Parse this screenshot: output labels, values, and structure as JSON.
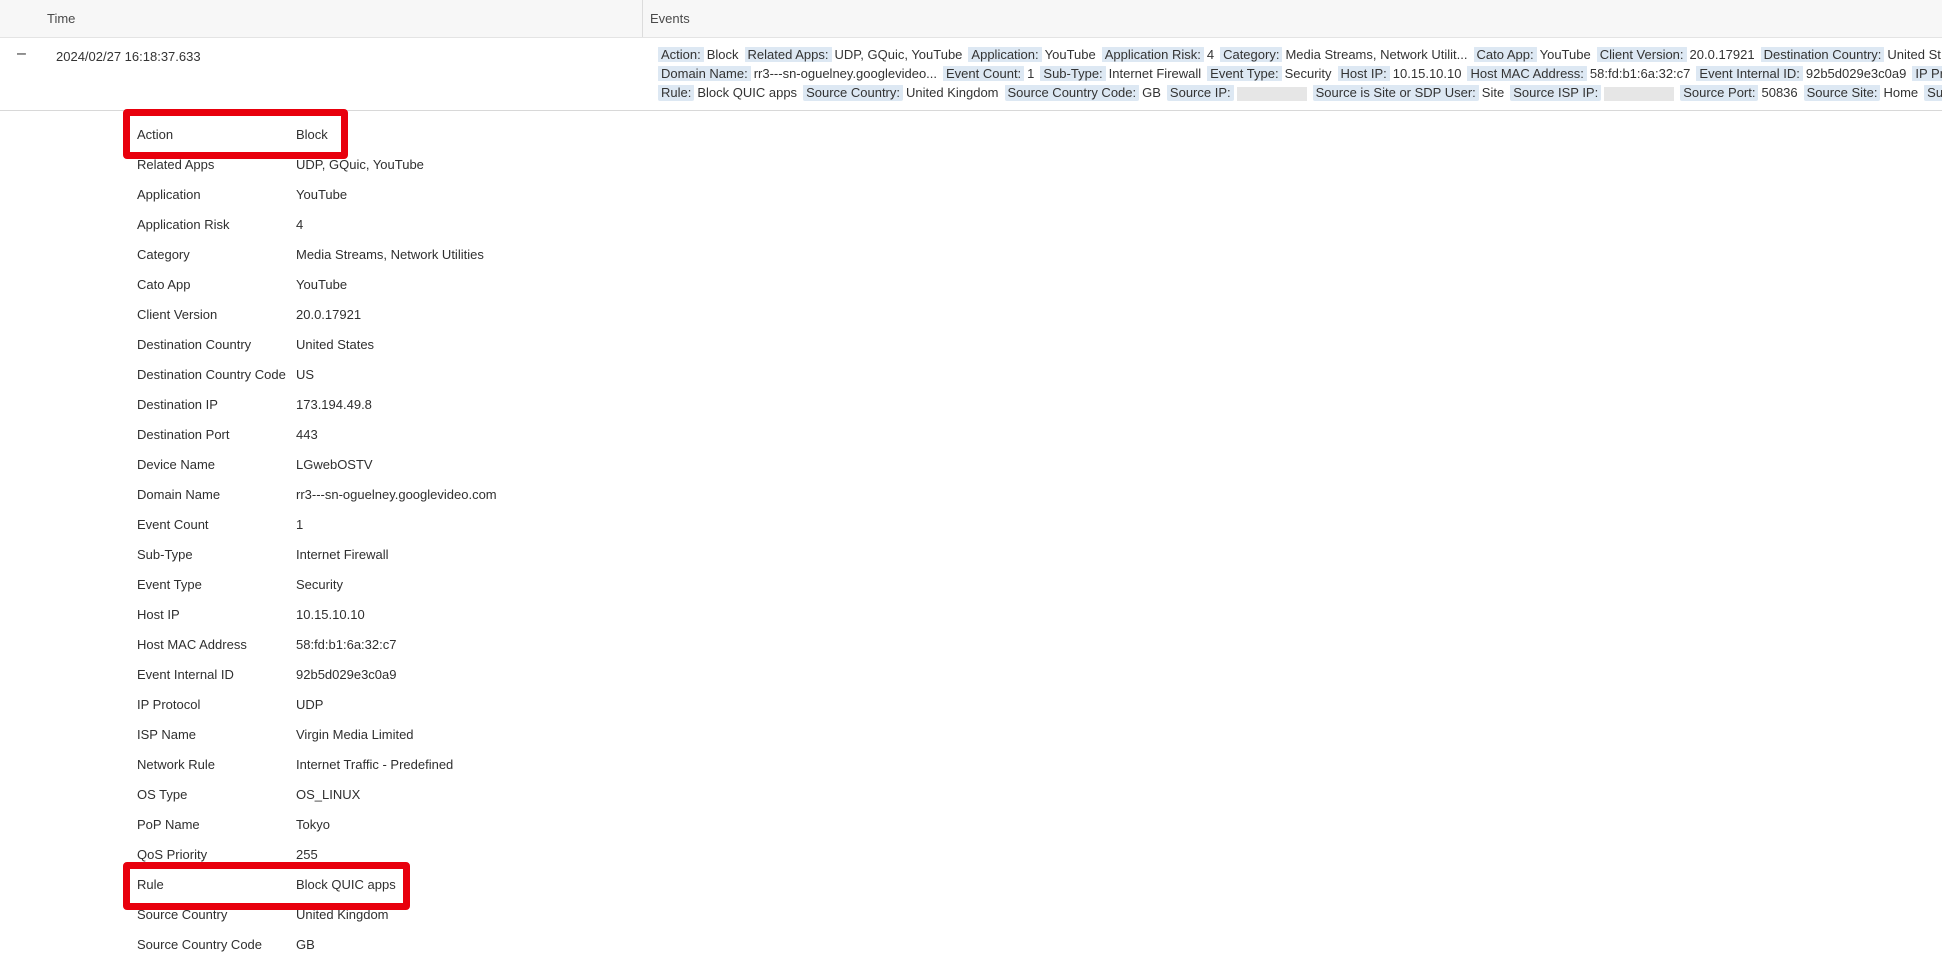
{
  "header": {
    "time_label": "Time",
    "events_label": "Events"
  },
  "event": {
    "toggle_symbol": "–",
    "time": "2024/02/27 16:18:37.633",
    "summary_line1": [
      {
        "k": "Action:",
        "v": "Block"
      },
      {
        "k": "Related Apps:",
        "v": "UDP, GQuic, YouTube"
      },
      {
        "k": "Application:",
        "v": "YouTube"
      },
      {
        "k": "Application Risk:",
        "v": "4"
      },
      {
        "k": "Category:",
        "v": "Media Streams, Network Utilit..."
      },
      {
        "k": "Cato App:",
        "v": "YouTube"
      },
      {
        "k": "Client Version:",
        "v": "20.0.17921"
      },
      {
        "k": "Destination Country:",
        "v": "United St"
      }
    ],
    "summary_line2": [
      {
        "k": "Domain Name:",
        "v": "rr3---sn-oguelney.googlevideo..."
      },
      {
        "k": "Event Count:",
        "v": "1"
      },
      {
        "k": "Sub-Type:",
        "v": "Internet Firewall"
      },
      {
        "k": "Event Type:",
        "v": "Security"
      },
      {
        "k": "Host IP:",
        "v": "10.15.10.10"
      },
      {
        "k": "Host MAC Address:",
        "v": "58:fd:b1:6a:32:c7"
      },
      {
        "k": "Event Internal ID:",
        "v": "92b5d029e3c0a9"
      },
      {
        "k": "IP Pr",
        "v": ""
      }
    ],
    "summary_line3": [
      {
        "k": "Rule:",
        "v": "Block QUIC apps"
      },
      {
        "k": "Source Country:",
        "v": "United Kingdom"
      },
      {
        "k": "Source Country Code:",
        "v": "GB"
      },
      {
        "k": "Source IP:",
        "v": "",
        "blur": true
      },
      {
        "k": "Source is Site or SDP User:",
        "v": "Site"
      },
      {
        "k": "Source ISP IP:",
        "v": "",
        "blur": true
      },
      {
        "k": "Source Port:",
        "v": "50836"
      },
      {
        "k": "Source Site:",
        "v": "Home"
      },
      {
        "k": "Sub",
        "v": ""
      }
    ]
  },
  "details": [
    {
      "k": "Action",
      "v": "Block"
    },
    {
      "k": "Related Apps",
      "v": "UDP, GQuic, YouTube"
    },
    {
      "k": "Application",
      "v": "YouTube"
    },
    {
      "k": "Application Risk",
      "v": "4"
    },
    {
      "k": "Category",
      "v": "Media Streams, Network Utilities"
    },
    {
      "k": "Cato App",
      "v": "YouTube"
    },
    {
      "k": "Client Version",
      "v": "20.0.17921"
    },
    {
      "k": "Destination Country",
      "v": "United States"
    },
    {
      "k": "Destination Country Code",
      "v": "US"
    },
    {
      "k": "Destination IP",
      "v": "173.194.49.8"
    },
    {
      "k": "Destination Port",
      "v": "443"
    },
    {
      "k": "Device Name",
      "v": "LGwebOSTV"
    },
    {
      "k": "Domain Name",
      "v": "rr3---sn-oguelney.googlevideo.com"
    },
    {
      "k": "Event Count",
      "v": "1"
    },
    {
      "k": "Sub-Type",
      "v": "Internet Firewall"
    },
    {
      "k": "Event Type",
      "v": "Security"
    },
    {
      "k": "Host IP",
      "v": "10.15.10.10"
    },
    {
      "k": "Host MAC Address",
      "v": "58:fd:b1:6a:32:c7"
    },
    {
      "k": "Event Internal ID",
      "v": "92b5d029e3c0a9"
    },
    {
      "k": "IP Protocol",
      "v": "UDP"
    },
    {
      "k": "ISP Name",
      "v": "Virgin Media Limited"
    },
    {
      "k": "Network Rule",
      "v": "Internet Traffic - Predefined"
    },
    {
      "k": "OS Type",
      "v": "OS_LINUX"
    },
    {
      "k": "PoP Name",
      "v": "Tokyo"
    },
    {
      "k": "QoS Priority",
      "v": "255"
    },
    {
      "k": "Rule",
      "v": "Block QUIC apps"
    },
    {
      "k": "Source Country",
      "v": "United Kingdom"
    },
    {
      "k": "Source Country Code",
      "v": "GB"
    }
  ],
  "colors": {
    "highlight": "#e8000d",
    "key_chip": "#dde8f3"
  }
}
